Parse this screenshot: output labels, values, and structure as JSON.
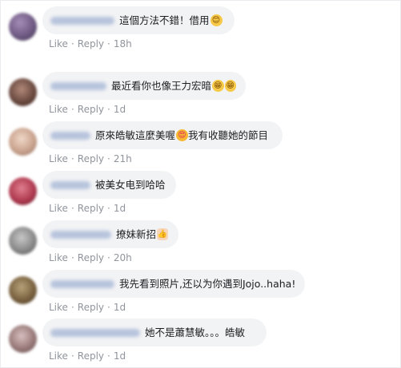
{
  "actions": {
    "like": "Like",
    "reply": "Reply",
    "sep": "·"
  },
  "comments": [
    {
      "text": "這個方法不錯！借用",
      "emoji": "😊",
      "emoji2": "",
      "time": "18h",
      "emoji_type": "smile"
    },
    {
      "text": "最近看你也像王力宏暗",
      "emoji": "😁",
      "emoji2": "😁",
      "time": "1d",
      "emoji_type": "grin"
    },
    {
      "text": "原來皓敏這麼美喔",
      "emoji": "😍",
      "emoji2": "",
      "text_after": "我有收聽她的節目",
      "time": "21h",
      "emoji_type": "love"
    },
    {
      "text": "被美女电到哈哈",
      "emoji": "",
      "emoji2": "",
      "time": "1d"
    },
    {
      "text": "撩妹新招",
      "emoji": "👍",
      "emoji2": "",
      "time": "20h",
      "emoji_type": "hand"
    },
    {
      "text": "我先看到照片,还以为你遇到Jojo..haha!",
      "emoji": "",
      "emoji2": "",
      "time": "1d"
    },
    {
      "text": "她不是蕭慧敏。。。皓敏",
      "emoji": "",
      "emoji2": "",
      "time": "1d"
    }
  ],
  "colors": {
    "bubble": "#f2f3f5",
    "meta_text": "#90949c",
    "author_blur": "#b7c4dc"
  }
}
